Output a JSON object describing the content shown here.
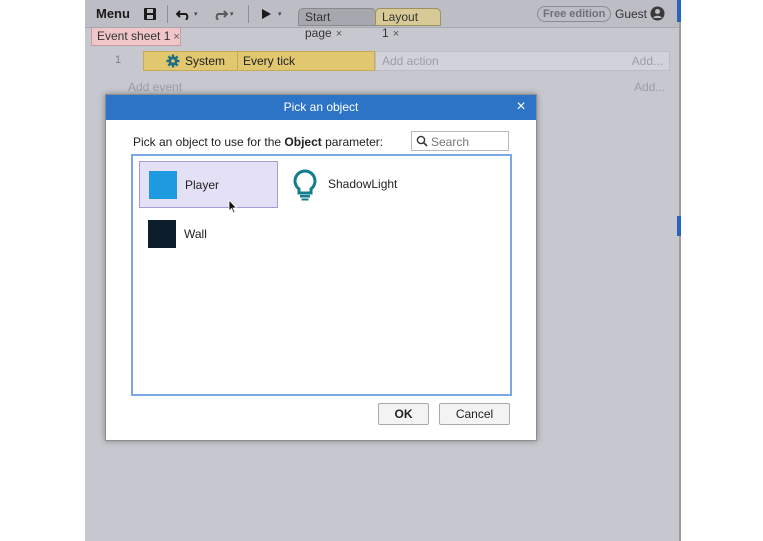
{
  "toolbar": {
    "menu_label": "Menu",
    "icons": [
      "save-icon",
      "undo-icon",
      "redo-icon",
      "play-icon"
    ],
    "tabs": [
      {
        "label": "Start page",
        "close": "×"
      },
      {
        "label": "Layout 1",
        "close": "×"
      }
    ],
    "edition_badge": "Free edition",
    "user_label": "Guest"
  },
  "sheet_tab": {
    "label": "Event sheet 1",
    "close": "×"
  },
  "event": {
    "number": "1",
    "object_label": "System",
    "condition_label": "Every tick",
    "add_action_label": "Add action",
    "add_action_right": "Add..."
  },
  "add_event": {
    "label": "Add event",
    "right": "Add..."
  },
  "dialog": {
    "title": "Pick an object",
    "close": "×",
    "prompt_prefix": "Pick an object to use for the ",
    "prompt_bold": "Object",
    "prompt_suffix": " parameter:",
    "search_placeholder": "Search",
    "objects": [
      {
        "name": "Player",
        "icon": "square-sprite-icon",
        "color": "#1e9be0",
        "selected": true
      },
      {
        "name": "ShadowLight",
        "icon": "lightbulb-icon",
        "color": "#137d8e",
        "selected": false
      },
      {
        "name": "Wall",
        "icon": "square-sprite-icon",
        "color": "#0c1e2c",
        "selected": false
      }
    ],
    "ok_label": "OK",
    "cancel_label": "Cancel"
  },
  "colors": {
    "titlebar": "#2d73c6",
    "selection": "#e4e0f6",
    "list_border": "#79a9e4"
  }
}
